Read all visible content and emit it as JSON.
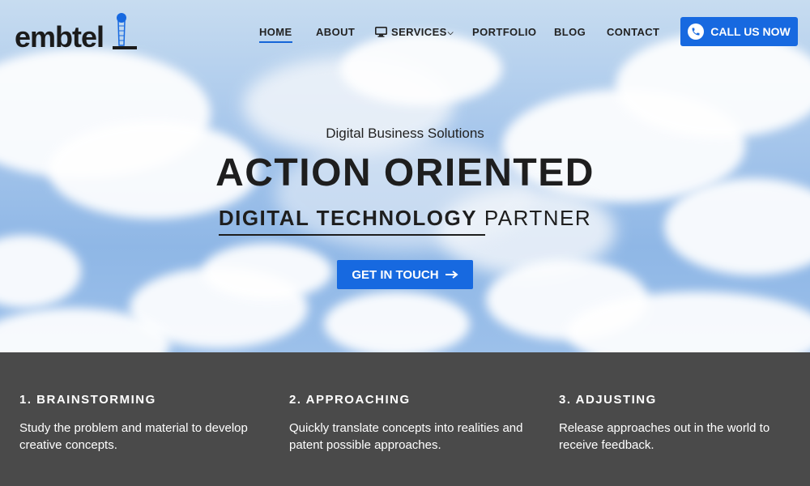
{
  "brand": {
    "logo_text": "embtel"
  },
  "nav": {
    "items": [
      {
        "label": "HOME",
        "active": true
      },
      {
        "label": "ABOUT"
      },
      {
        "label": "SERVICES",
        "icon": "monitor-icon",
        "has_dropdown": true
      },
      {
        "label": "PORTFOLIO"
      },
      {
        "label": "BLOG"
      },
      {
        "label": "CONTACT"
      }
    ],
    "call_button": {
      "label": "CALL US NOW",
      "icon": "phone-icon"
    }
  },
  "hero": {
    "subtitle": "Digital Business Solutions",
    "headline": "ACTION ORIENTED",
    "tagline_bold": "DIGITAL TECHNOLOGY",
    "tagline_rest": "PARTNER",
    "cta_label": "GET IN TOUCH",
    "cta_icon": "arrow-right-icon"
  },
  "steps": [
    {
      "title": "1. BRAINSTORMING",
      "text": "Study the problem and material to develop creative concepts."
    },
    {
      "title": "2. APPROACHING",
      "text": "Quickly translate concepts into realities and patent possible approaches."
    },
    {
      "title": "3. ADJUSTING",
      "text": "Release approaches out in the world to receive feedback."
    }
  ],
  "colors": {
    "accent": "#1769e0",
    "dark_band": "#4a4a4a",
    "text_dark": "#1e1e1e"
  }
}
